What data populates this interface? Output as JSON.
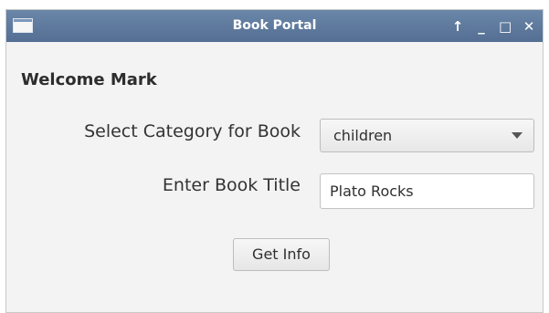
{
  "window": {
    "title": "Book Portal",
    "controls": {
      "up": "↑",
      "minimize": "_",
      "maximize": "□",
      "close": "✕"
    }
  },
  "form": {
    "welcome": "Welcome Mark",
    "category_label": "Select Category for Book",
    "category_selected": "children",
    "title_label": "Enter Book Title",
    "title_value": "Plato Rocks",
    "submit_label": "Get Info"
  },
  "colors": {
    "titlebar": "#546f93",
    "window_bg": "#f3f3f3"
  },
  "icons": [
    "app-window-icon",
    "arrow-up-icon",
    "minimize-icon",
    "maximize-icon",
    "close-icon",
    "chevron-down-icon"
  ]
}
